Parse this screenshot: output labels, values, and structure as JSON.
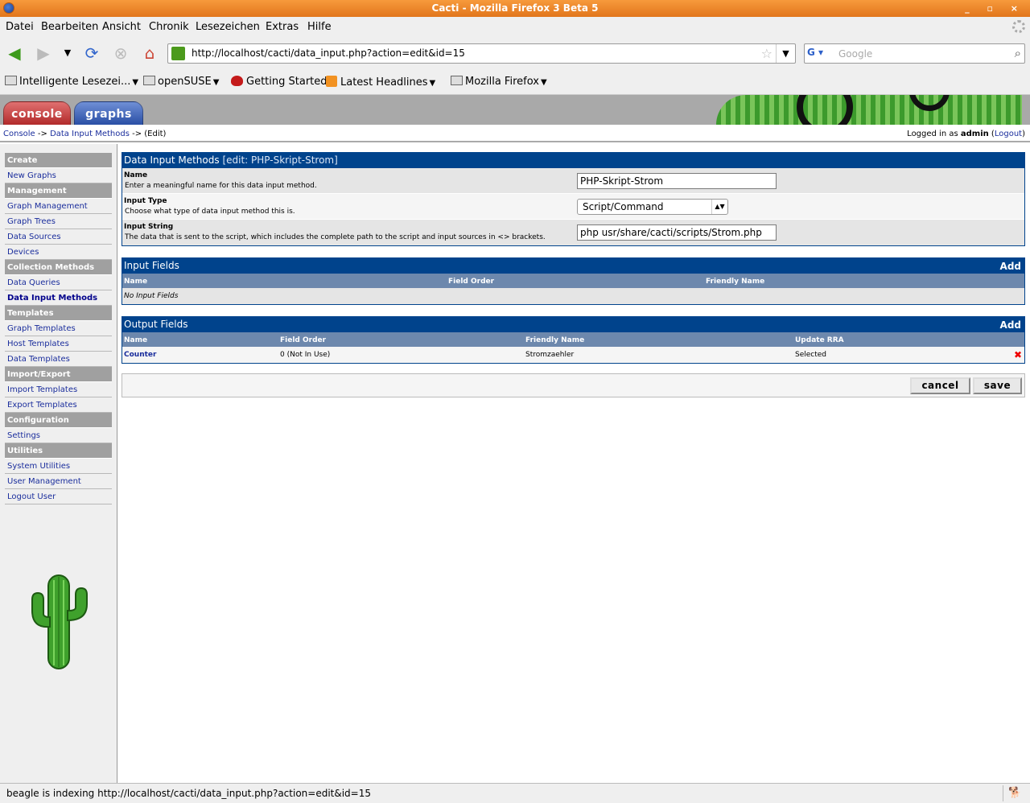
{
  "window": {
    "title": "Cacti - Mozilla Firefox 3 Beta 5",
    "controls": "_ ▫ ×"
  },
  "menubar": {
    "items": [
      {
        "label": "Datei"
      },
      {
        "label": "Bearbeiten"
      },
      {
        "label": "Ansicht"
      },
      {
        "label": "Chronik"
      },
      {
        "label": "Lesezeichen"
      },
      {
        "label": "Extras"
      },
      {
        "label": "Hilfe"
      }
    ]
  },
  "nav": {
    "url": "http://localhost/cacti/data_input.php?action=edit&id=15",
    "search_placeholder": "Google",
    "search_engine": "G"
  },
  "bookmarks": [
    {
      "label": "Intelligente Lesezei..."
    },
    {
      "label": "openSUSE"
    },
    {
      "label": "Getting Started"
    },
    {
      "label": "Latest Headlines"
    },
    {
      "label": "Mozilla Firefox"
    }
  ],
  "tabs": {
    "console": "console",
    "graphs": "graphs"
  },
  "breadcrumb": {
    "console": "Console",
    "sep1": " -> ",
    "data_input": "Data Input Methods",
    "sep2": " -> ",
    "edit": "(Edit)"
  },
  "login": {
    "prefix": "Logged in as ",
    "user": "admin",
    "open": " (",
    "logout": "Logout",
    "close": ")"
  },
  "sidebar": {
    "sections": [
      {
        "header": "Create",
        "items": [
          "New Graphs"
        ]
      },
      {
        "header": "Management",
        "items": [
          "Graph Management",
          "Graph Trees",
          "Data Sources",
          "Devices"
        ]
      },
      {
        "header": "Collection Methods",
        "items": [
          "Data Queries",
          "Data Input Methods"
        ]
      },
      {
        "header": "Templates",
        "items": [
          "Graph Templates",
          "Host Templates",
          "Data Templates"
        ]
      },
      {
        "header": "Import/Export",
        "items": [
          "Import Templates",
          "Export Templates"
        ]
      },
      {
        "header": "Configuration",
        "items": [
          "Settings"
        ]
      },
      {
        "header": "Utilities",
        "items": [
          "System Utilities",
          "User Management",
          "Logout User"
        ]
      }
    ],
    "selected": "Data Input Methods"
  },
  "form": {
    "title": "Data Input Methods",
    "subtitle": "[edit: PHP-Skript-Strom]",
    "fields": {
      "name": {
        "label": "Name",
        "desc": "Enter a meaningful name for this data input method.",
        "value": "PHP-Skript-Strom"
      },
      "type": {
        "label": "Input Type",
        "desc": "Choose what type of data input method this is.",
        "value": "Script/Command"
      },
      "string": {
        "label": "Input String",
        "desc": "The data that is sent to the script, which includes the complete path to the script and input sources in <> brackets.",
        "value": "php usr/share/cacti/scripts/Strom.php"
      }
    }
  },
  "input_fields": {
    "title": "Input Fields",
    "add": "Add",
    "columns": [
      "Name",
      "Field Order",
      "Friendly Name"
    ],
    "empty": "No Input Fields"
  },
  "output_fields": {
    "title": "Output Fields",
    "add": "Add",
    "columns": [
      "Name",
      "Field Order",
      "Friendly Name",
      "Update RRA"
    ],
    "rows": [
      {
        "name": "Counter",
        "order": "0 (Not In Use)",
        "friendly": "Stromzaehler",
        "rra": "Selected",
        "delete": "✖"
      }
    ]
  },
  "buttons": {
    "cancel": "cancel",
    "save": "save"
  },
  "status": {
    "text": "beagle is indexing http://localhost/cacti/data_input.php?action=edit&id=15"
  }
}
